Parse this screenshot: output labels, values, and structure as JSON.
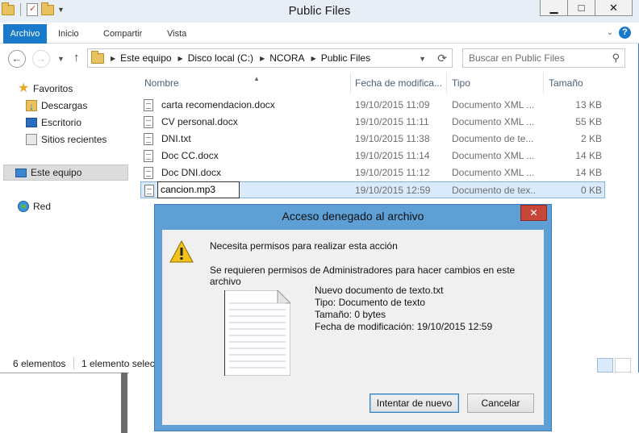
{
  "window": {
    "title": "Public Files"
  },
  "controls": {
    "minimize": "▁",
    "maximize": "□",
    "close": "✕"
  },
  "ribbon": {
    "tabs": [
      "Archivo",
      "Inicio",
      "Compartir",
      "Vista"
    ],
    "expand": "⌄",
    "help": "?"
  },
  "nav": {
    "back": "←",
    "forward": "→",
    "up": "↑",
    "breadcrumb": [
      "Este equipo",
      "Disco local (C:)",
      "NCORA",
      "Public Files"
    ],
    "search_placeholder": "Buscar en Public Files"
  },
  "sidebar": {
    "items": [
      {
        "label": "Favoritos",
        "icon": "star-icon"
      },
      {
        "label": "Descargas",
        "icon": "downloads-icon"
      },
      {
        "label": "Escritorio",
        "icon": "desktop-icon"
      },
      {
        "label": "Sitios recientes",
        "icon": "recent-places-icon"
      },
      {
        "label": "Este equipo",
        "icon": "computer-icon"
      },
      {
        "label": "Red",
        "icon": "network-icon"
      }
    ]
  },
  "columns": [
    "Nombre",
    "Fecha de modifica...",
    "Tipo",
    "Tamaño"
  ],
  "files": [
    {
      "name": "carta recomendacion.docx",
      "date": "19/10/2015 11:09",
      "type": "Documento XML ...",
      "size": "13 KB"
    },
    {
      "name": "CV personal.docx",
      "date": "19/10/2015 11:11",
      "type": "Documento XML ...",
      "size": "55 KB"
    },
    {
      "name": "DNI.txt",
      "date": "19/10/2015 11:38",
      "type": "Documento de te...",
      "size": "2 KB"
    },
    {
      "name": "Doc CC.docx",
      "date": "19/10/2015 11:14",
      "type": "Documento XML ...",
      "size": "14 KB"
    },
    {
      "name": "Doc DNI.docx",
      "date": "19/10/2015 11:12",
      "type": "Documento XML ...",
      "size": "14 KB"
    },
    {
      "name": "cancion.mp3",
      "date": "19/10/2015 12:59",
      "type": "Documento de tex...",
      "size": "0 KB"
    }
  ],
  "status": {
    "count": "6 elementos",
    "selected": "1 elemento selecc"
  },
  "dialog": {
    "title": "Acceso denegado al archivo",
    "close": "✕",
    "message1": "Necesita permisos para realizar esta acción",
    "message2": "Se requieren permisos de Administradores para hacer cambios en este archivo",
    "file_name": "Nuevo documento de texto.txt",
    "file_type": "Tipo: Documento de texto",
    "file_size": "Tamaño: 0 bytes",
    "file_date": "Fecha de modificación: 19/10/2015 12:59",
    "retry": "Intentar de nuevo",
    "cancel": "Cancelar"
  }
}
